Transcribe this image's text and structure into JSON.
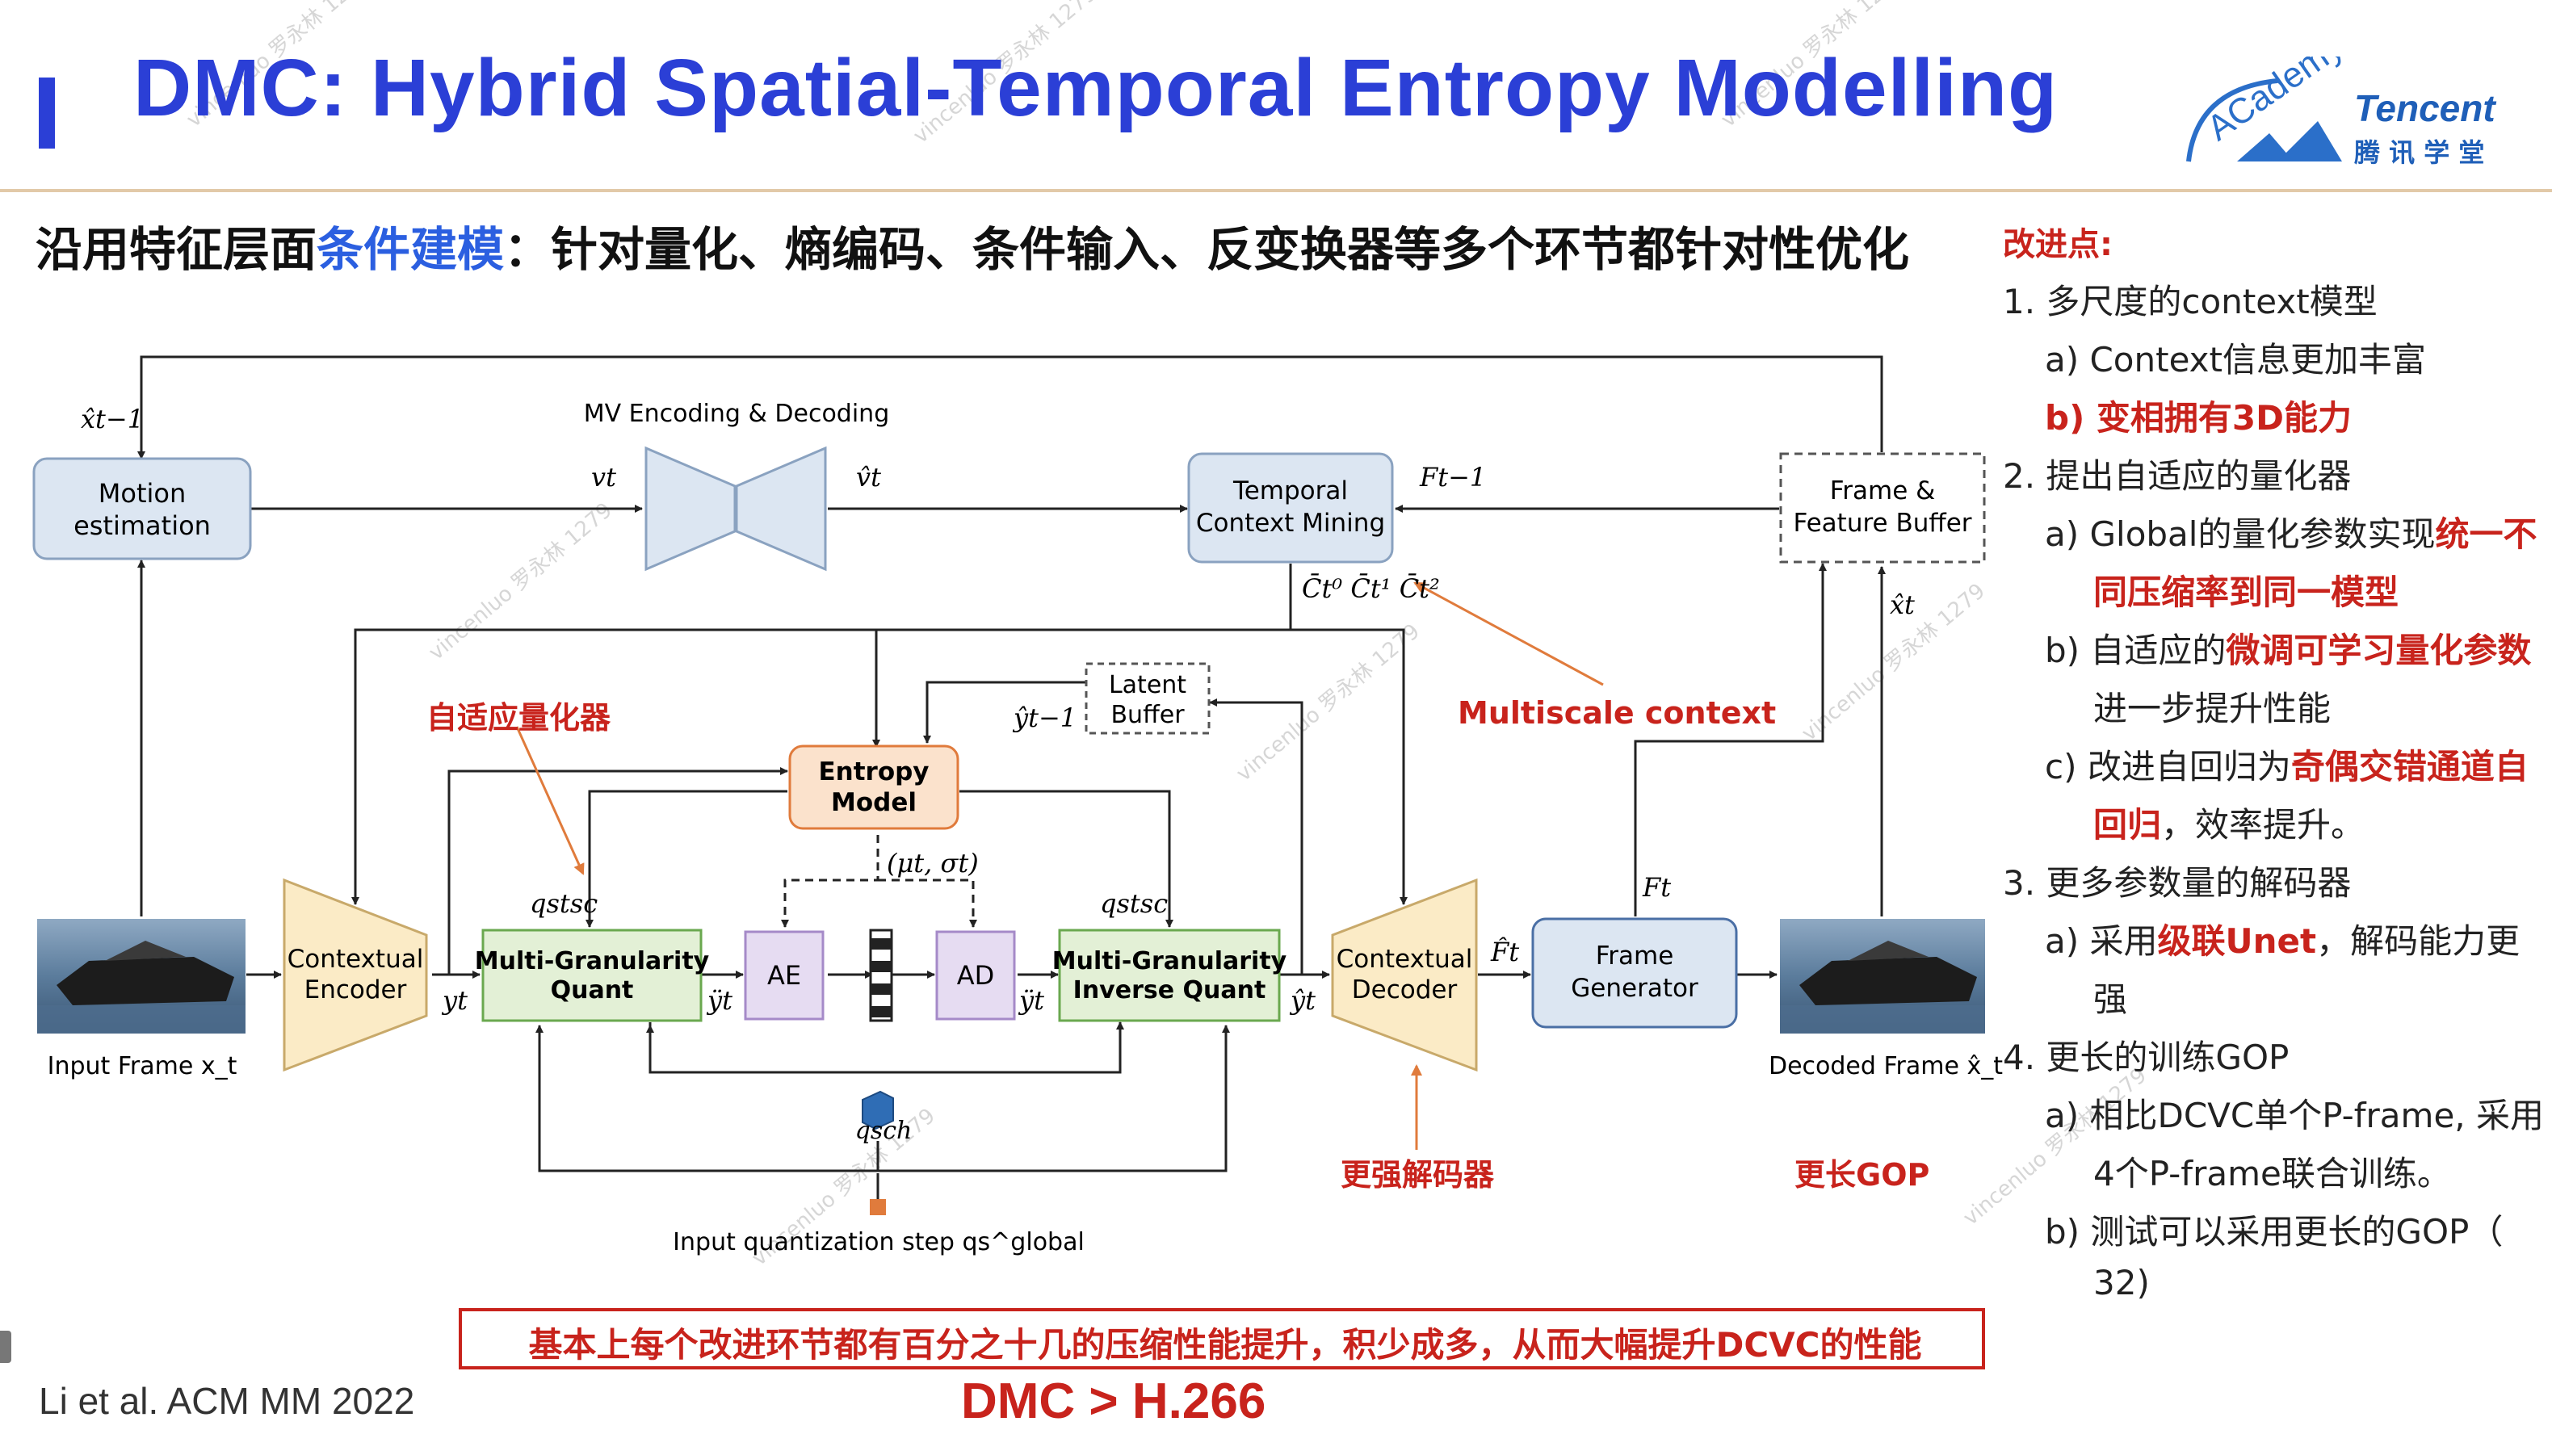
{
  "header": {
    "title": "DMC: Hybrid Spatial-Temporal Entropy Modelling",
    "logo_top": "ACademy",
    "logo_brand": "Tencent",
    "logo_cn": "腾 讯 学 堂"
  },
  "subtitle": {
    "prefix": "沿用特征层面",
    "highlight": "条件建模",
    "suffix": "：针对量化、熵编码、条件输入、反变换器等多个环节都针对性优化"
  },
  "diagram": {
    "motion_estimation": "Motion estimation",
    "motion_estimation_l1": "Motion",
    "motion_estimation_l2": "estimation",
    "mv_label": "MV Encoding & Decoding",
    "temporal_l1": "Temporal",
    "temporal_l2": "Context Mining",
    "buffer_l1": "Frame &",
    "buffer_l2": "Feature Buffer",
    "latent_l1": "Latent",
    "latent_l2": "Buffer",
    "entropy_l1": "Entropy",
    "entropy_l2": "Model",
    "ctx_enc_l1": "Contextual",
    "ctx_enc_l2": "Encoder",
    "mgq_l1": "Multi-Granularity",
    "mgq_l2": "Quant",
    "ae": "AE",
    "ad": "AD",
    "mgiq_l1": "Multi-Granularity",
    "mgiq_l2": "Inverse Quant",
    "ctx_dec_l1": "Contextual",
    "ctx_dec_l2": "Decoder",
    "fg_l1": "Frame",
    "fg_l2": "Generator",
    "input_frame": "Input Frame x_t",
    "decoded_frame": "Decoded Frame x̂_t",
    "input_qstep": "Input quantization step qs^global",
    "sym_xhat_prev": "x̂t−1",
    "sym_vt": "vt",
    "sym_vhat": "v̂t",
    "sym_fprev": "Ft−1",
    "sym_ctx": "C̄t⁰ C̄t¹ C̄t²",
    "sym_xhat": "x̂t",
    "sym_yhat_prev": "ŷt−1",
    "sym_musigma": "(μt, σt)",
    "sym_qssc1": "qstsc",
    "sym_qssc2": "qstsc",
    "sym_yt": "yt",
    "sym_ydd1": "ÿt",
    "sym_ydd2": "ÿt",
    "sym_yhat": "ŷt",
    "sym_fhat": "F̂t",
    "sym_ft": "Ft",
    "sym_qsch": "qsch",
    "ann_quantizer": "自适应量化器",
    "ann_multiscale": "Multiscale context",
    "ann_decoder": "更强解码器",
    "ann_gop": "更长GOP"
  },
  "notes": {
    "title": "改进点:",
    "n1": "1.  多尺度的context模型",
    "n1a": "a)  Context信息更加丰富",
    "n1b": "b)  变相拥有3D能力",
    "n2": "2.  提出自适应的量化器",
    "n2a_pre": "a)  Global的量化参数实现",
    "n2a_red": "统一不",
    "n2a_cont": "同压缩率到同一模型",
    "n2b_pre": "b)  自适应的",
    "n2b_red": "微调可学习量化参数",
    "n2b_cont": "进一步提升性能",
    "n2c_pre": "c)  改进自回归为",
    "n2c_red": "奇偶交错通道自",
    "n2c_cont_red": "回归",
    "n2c_cont": "，效率提升。",
    "n3": "3.  更多参数量的解码器",
    "n3a_pre": "a)  采用",
    "n3a_red": "级联Unet",
    "n3a_post": "，解码能力更",
    "n3a_cont": "强",
    "n4": "4.  更长的训练GOP",
    "n4a": "a)  相比DCVC单个P-frame, 采用",
    "n4a_cont": "4个P-frame联合训练。",
    "n4b": "b)  测试可以采用更长的GOP（",
    "n4b_cont": "32)"
  },
  "bottom": {
    "summary": "基本上每个改进环节都有百分之十几的压缩性能提升，积少成多，从而大幅提升DCVC的性能",
    "citation": "Li et al. ACM MM 2022",
    "result": "DMC > H.266"
  },
  "watermark": "vincenluo 罗永林 1279",
  "colors": {
    "title": "#2b3fd6",
    "accent_red": "#c8231c",
    "box_blue": "#dce6f2",
    "box_green": "#e3f0d6",
    "box_orange": "#fbe2cc",
    "box_purple": "#e6dcf2",
    "box_tan": "#fbebc6"
  }
}
